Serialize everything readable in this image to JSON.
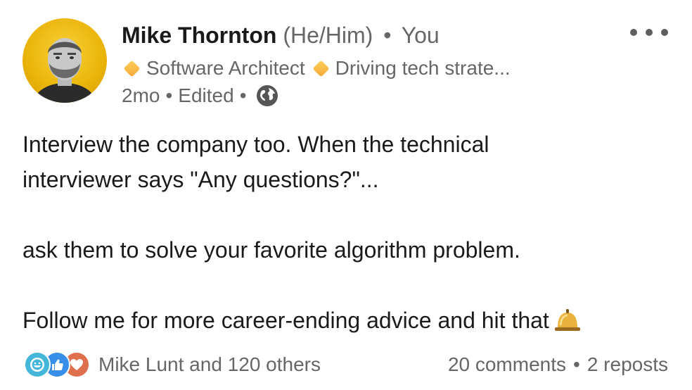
{
  "author": {
    "name": "Mike Thornton",
    "pronouns": "(He/Him)",
    "separator": "•",
    "relation": "You",
    "headline_role": "Software Architect",
    "headline_tagline": "Driving tech strate...",
    "time": "2mo",
    "edited": "Edited"
  },
  "post": {
    "line1": "Interview the company too. When the technical",
    "line2": "interviewer says \"Any questions?\"...",
    "line3": "ask them to solve your favorite algorithm problem.",
    "line4": "Follow me for more career-ending advice and hit that"
  },
  "social": {
    "reactors": "Mike Lunt and 120 others",
    "comments": "20 comments",
    "reposts": "2 reposts",
    "separator": "•"
  },
  "icons": {
    "more": "more-options-icon",
    "visibility": "globe-icon",
    "bell": "bell-icon",
    "reactions": [
      "funny-reaction-icon",
      "like-reaction-icon",
      "love-reaction-icon"
    ]
  },
  "colors": {
    "avatar_bg": "#eab308",
    "like": "#378fe9",
    "funny": "#44b6d9",
    "love": "#df704d",
    "headline_diamond": "#f4a93a"
  }
}
